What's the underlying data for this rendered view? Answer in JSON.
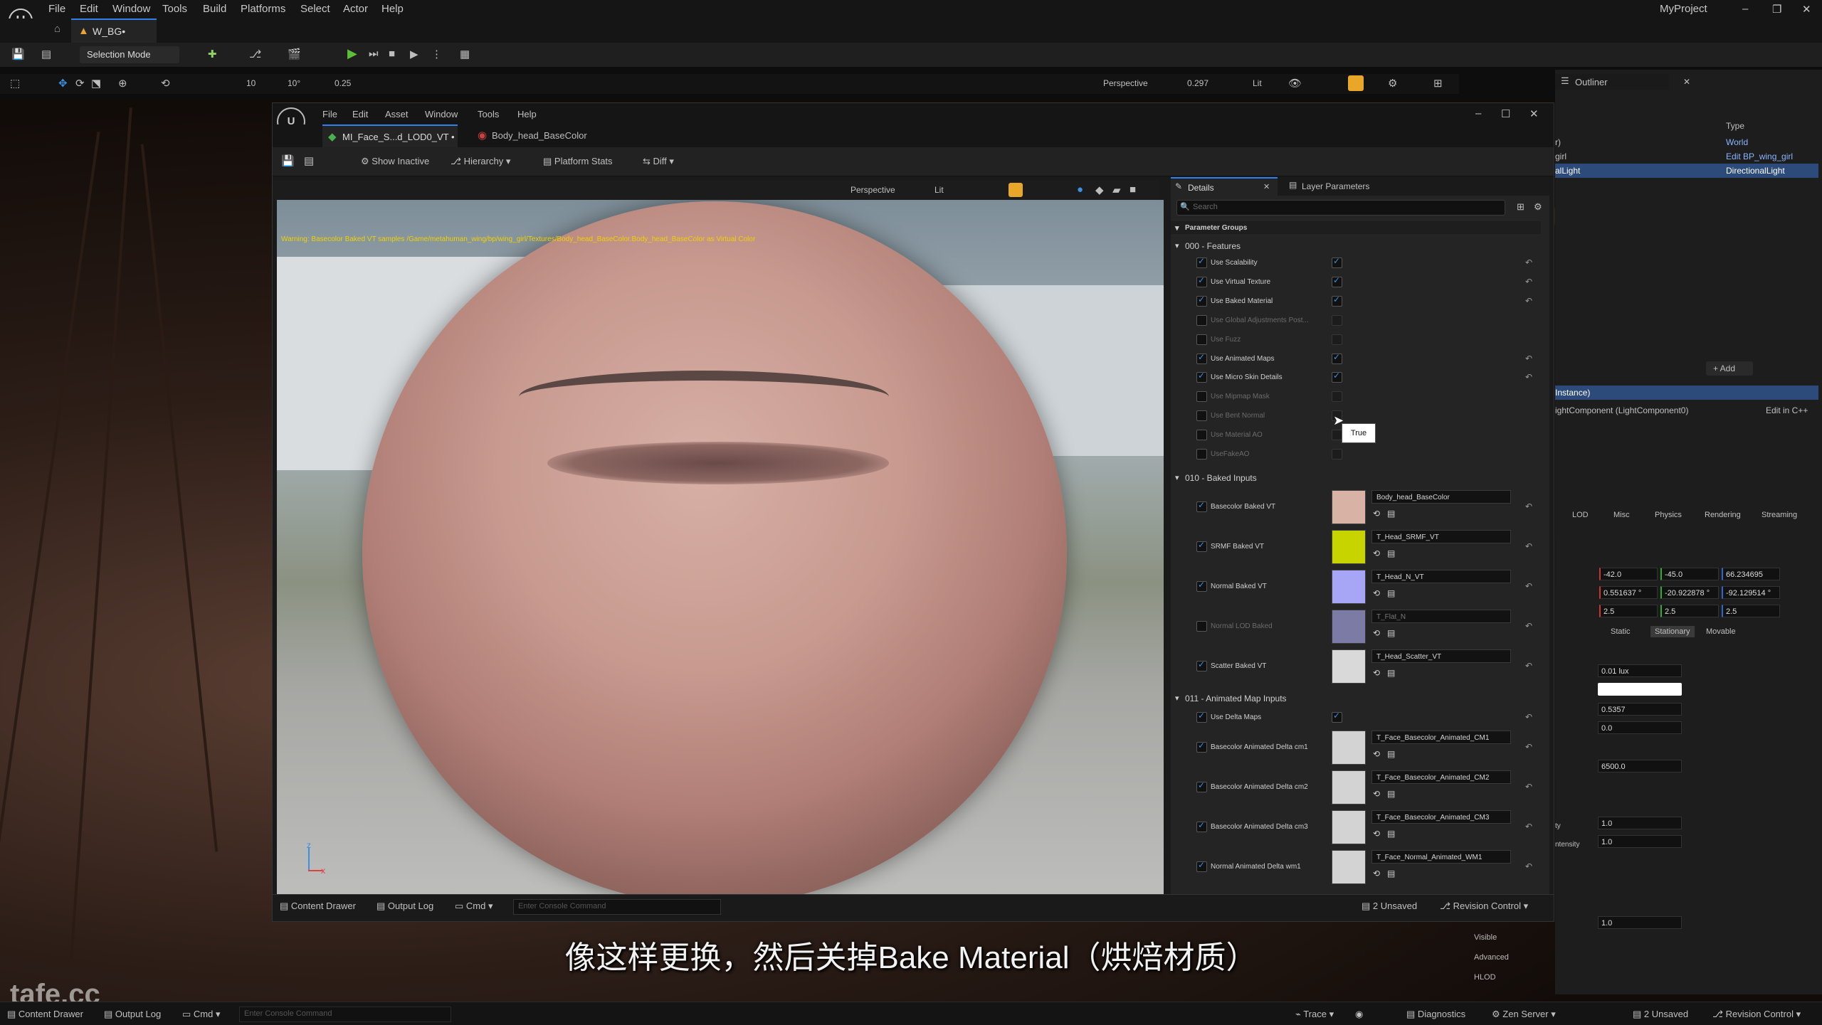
{
  "app": {
    "menu": [
      "File",
      "Edit",
      "Window",
      "Tools",
      "Build",
      "Platforms",
      "Select",
      "Actor",
      "Help"
    ],
    "project_name": "MyProject",
    "level_tab": "W_BG•",
    "selection_mode": "Selection Mode",
    "viewport": {
      "mode": "Perspective",
      "fov": "0.297",
      "lit": "Lit",
      "grid": "10",
      "rot": "10°",
      "scale": "0.25"
    },
    "outliner": {
      "title": "Outliner",
      "type_header": "Type",
      "rows": [
        {
          "name": "r)",
          "type": "World"
        },
        {
          "name": "girl",
          "type": "Edit BP_wing_girl"
        },
        {
          "name": "alLight",
          "type": "DirectionalLight"
        }
      ]
    },
    "details_right": {
      "add": "+ Add",
      "instance_label": "Instance)",
      "component": "ightComponent (LightComponent0)",
      "edit_cpp": "Edit in C++",
      "tabs": [
        "LOD",
        "Misc",
        "Physics",
        "Rendering",
        "Streaming"
      ],
      "location": [
        "-42.0",
        "-45.0",
        "66.234695"
      ],
      "rotation": [
        "0.551637 °",
        "-20.922878 °",
        "-92.129514 °"
      ],
      "scale": [
        "2.5",
        "2.5",
        "2.5"
      ],
      "mobility": [
        "Static",
        "Stationary",
        "Movable"
      ],
      "intensity": "0.01 lux",
      "val1": "0.5357",
      "val2": "0.0",
      "temp": "6500.0",
      "v3": "1.0",
      "v4": "1.0",
      "v5": "1.0",
      "lbl_ty": "ty",
      "lbl_ntensity": "ntensity",
      "visible": "Visible",
      "advanced": "Advanced",
      "hlod": "HLOD"
    },
    "bottom": {
      "content_drawer": "Content Drawer",
      "output_log": "Output Log",
      "cmd": "Cmd",
      "console_placeholder": "Enter Console Command",
      "trace": "Trace",
      "diagnostics": "Diagnostics",
      "zen": "Zen Server",
      "unsaved": "2 Unsaved",
      "revision": "Revision Control"
    }
  },
  "material_editor": {
    "menu": [
      "File",
      "Edit",
      "Asset",
      "Window",
      "Tools",
      "Help"
    ],
    "tabs": [
      {
        "label": "MI_Face_S...d_LOD0_VT •",
        "active": true
      },
      {
        "label": "Body_head_BaseColor",
        "active": false
      }
    ],
    "toolbar": [
      "Show Inactive",
      "Hierarchy",
      "Platform Stats",
      "Diff"
    ],
    "viewport": {
      "mode": "Perspective",
      "lit": "Lit"
    },
    "warning": "Warning: Basecolor Baked VT samples /Game/metahuman_wing/bp/wing_girl/Textures/Body_head_BaseColor.Body_head_BaseColor as Virtual Color",
    "details": {
      "tab": "Details",
      "tab2": "Layer Parameters",
      "search_placeholder": "Search",
      "groups_label": "Parameter Groups",
      "group1": "000 - Features",
      "features": [
        {
          "label": "Use Scalability",
          "enabled": true,
          "checked": true
        },
        {
          "label": "Use Virtual Texture",
          "enabled": true,
          "checked": true
        },
        {
          "label": "Use Baked Material",
          "enabled": true,
          "checked": true
        },
        {
          "label": "Use Global Adjustments Post...",
          "enabled": false,
          "checked": false
        },
        {
          "label": "Use Fuzz",
          "enabled": false,
          "checked": false
        },
        {
          "label": "Use Animated Maps",
          "enabled": true,
          "checked": true
        },
        {
          "label": "Use Micro Skin Details",
          "enabled": true,
          "checked": true
        },
        {
          "label": "Use Mipmap Mask",
          "enabled": false,
          "checked": false
        },
        {
          "label": "Use Bent Normal",
          "enabled": false,
          "checked": false
        },
        {
          "label": "Use Material AO",
          "enabled": false,
          "checked": false
        },
        {
          "label": "UseFakeAO",
          "enabled": false,
          "checked": false
        }
      ],
      "tooltip": "True",
      "group2": "010 - Baked Inputs",
      "baked": [
        {
          "label": "Basecolor Baked VT",
          "enabled": true,
          "tex": "Body_head_BaseColor",
          "color": "#d8b2a5"
        },
        {
          "label": "SRMF Baked VT",
          "enabled": true,
          "tex": "T_Head_SRMF_VT",
          "color": "#c8d400"
        },
        {
          "label": "Normal Baked VT",
          "enabled": true,
          "tex": "T_Head_N_VT",
          "color": "#a7a6f6"
        },
        {
          "label": "Normal LOD Baked",
          "enabled": false,
          "tex": "T_Flat_N",
          "color": "#b7b6fb"
        },
        {
          "label": "Scatter Baked VT",
          "enabled": true,
          "tex": "T_Head_Scatter_VT",
          "color": "#d9d9d9"
        }
      ],
      "group3": "011 - Animated Map Inputs",
      "use_delta": "Use Delta Maps",
      "animated": [
        {
          "label": "Basecolor Animated Delta cm1",
          "tex": "T_Face_Basecolor_Animated_CM1"
        },
        {
          "label": "Basecolor Animated Delta cm2",
          "tex": "T_Face_Basecolor_Animated_CM2"
        },
        {
          "label": "Basecolor Animated Delta cm3",
          "tex": "T_Face_Basecolor_Animated_CM3"
        },
        {
          "label": "Normal Animated Delta wm1",
          "tex": "T_Face_Normal_Animated_WM1"
        }
      ]
    },
    "statusbar": {
      "content_drawer": "Content Drawer",
      "output_log": "Output Log",
      "cmd": "Cmd",
      "console_placeholder": "Enter Console Command",
      "unsaved": "2 Unsaved",
      "revision": "Revision Control"
    }
  },
  "subtitle": "像这样更换，然后关掉Bake Material（烘焙材质）",
  "watermark": "tafe.cc"
}
